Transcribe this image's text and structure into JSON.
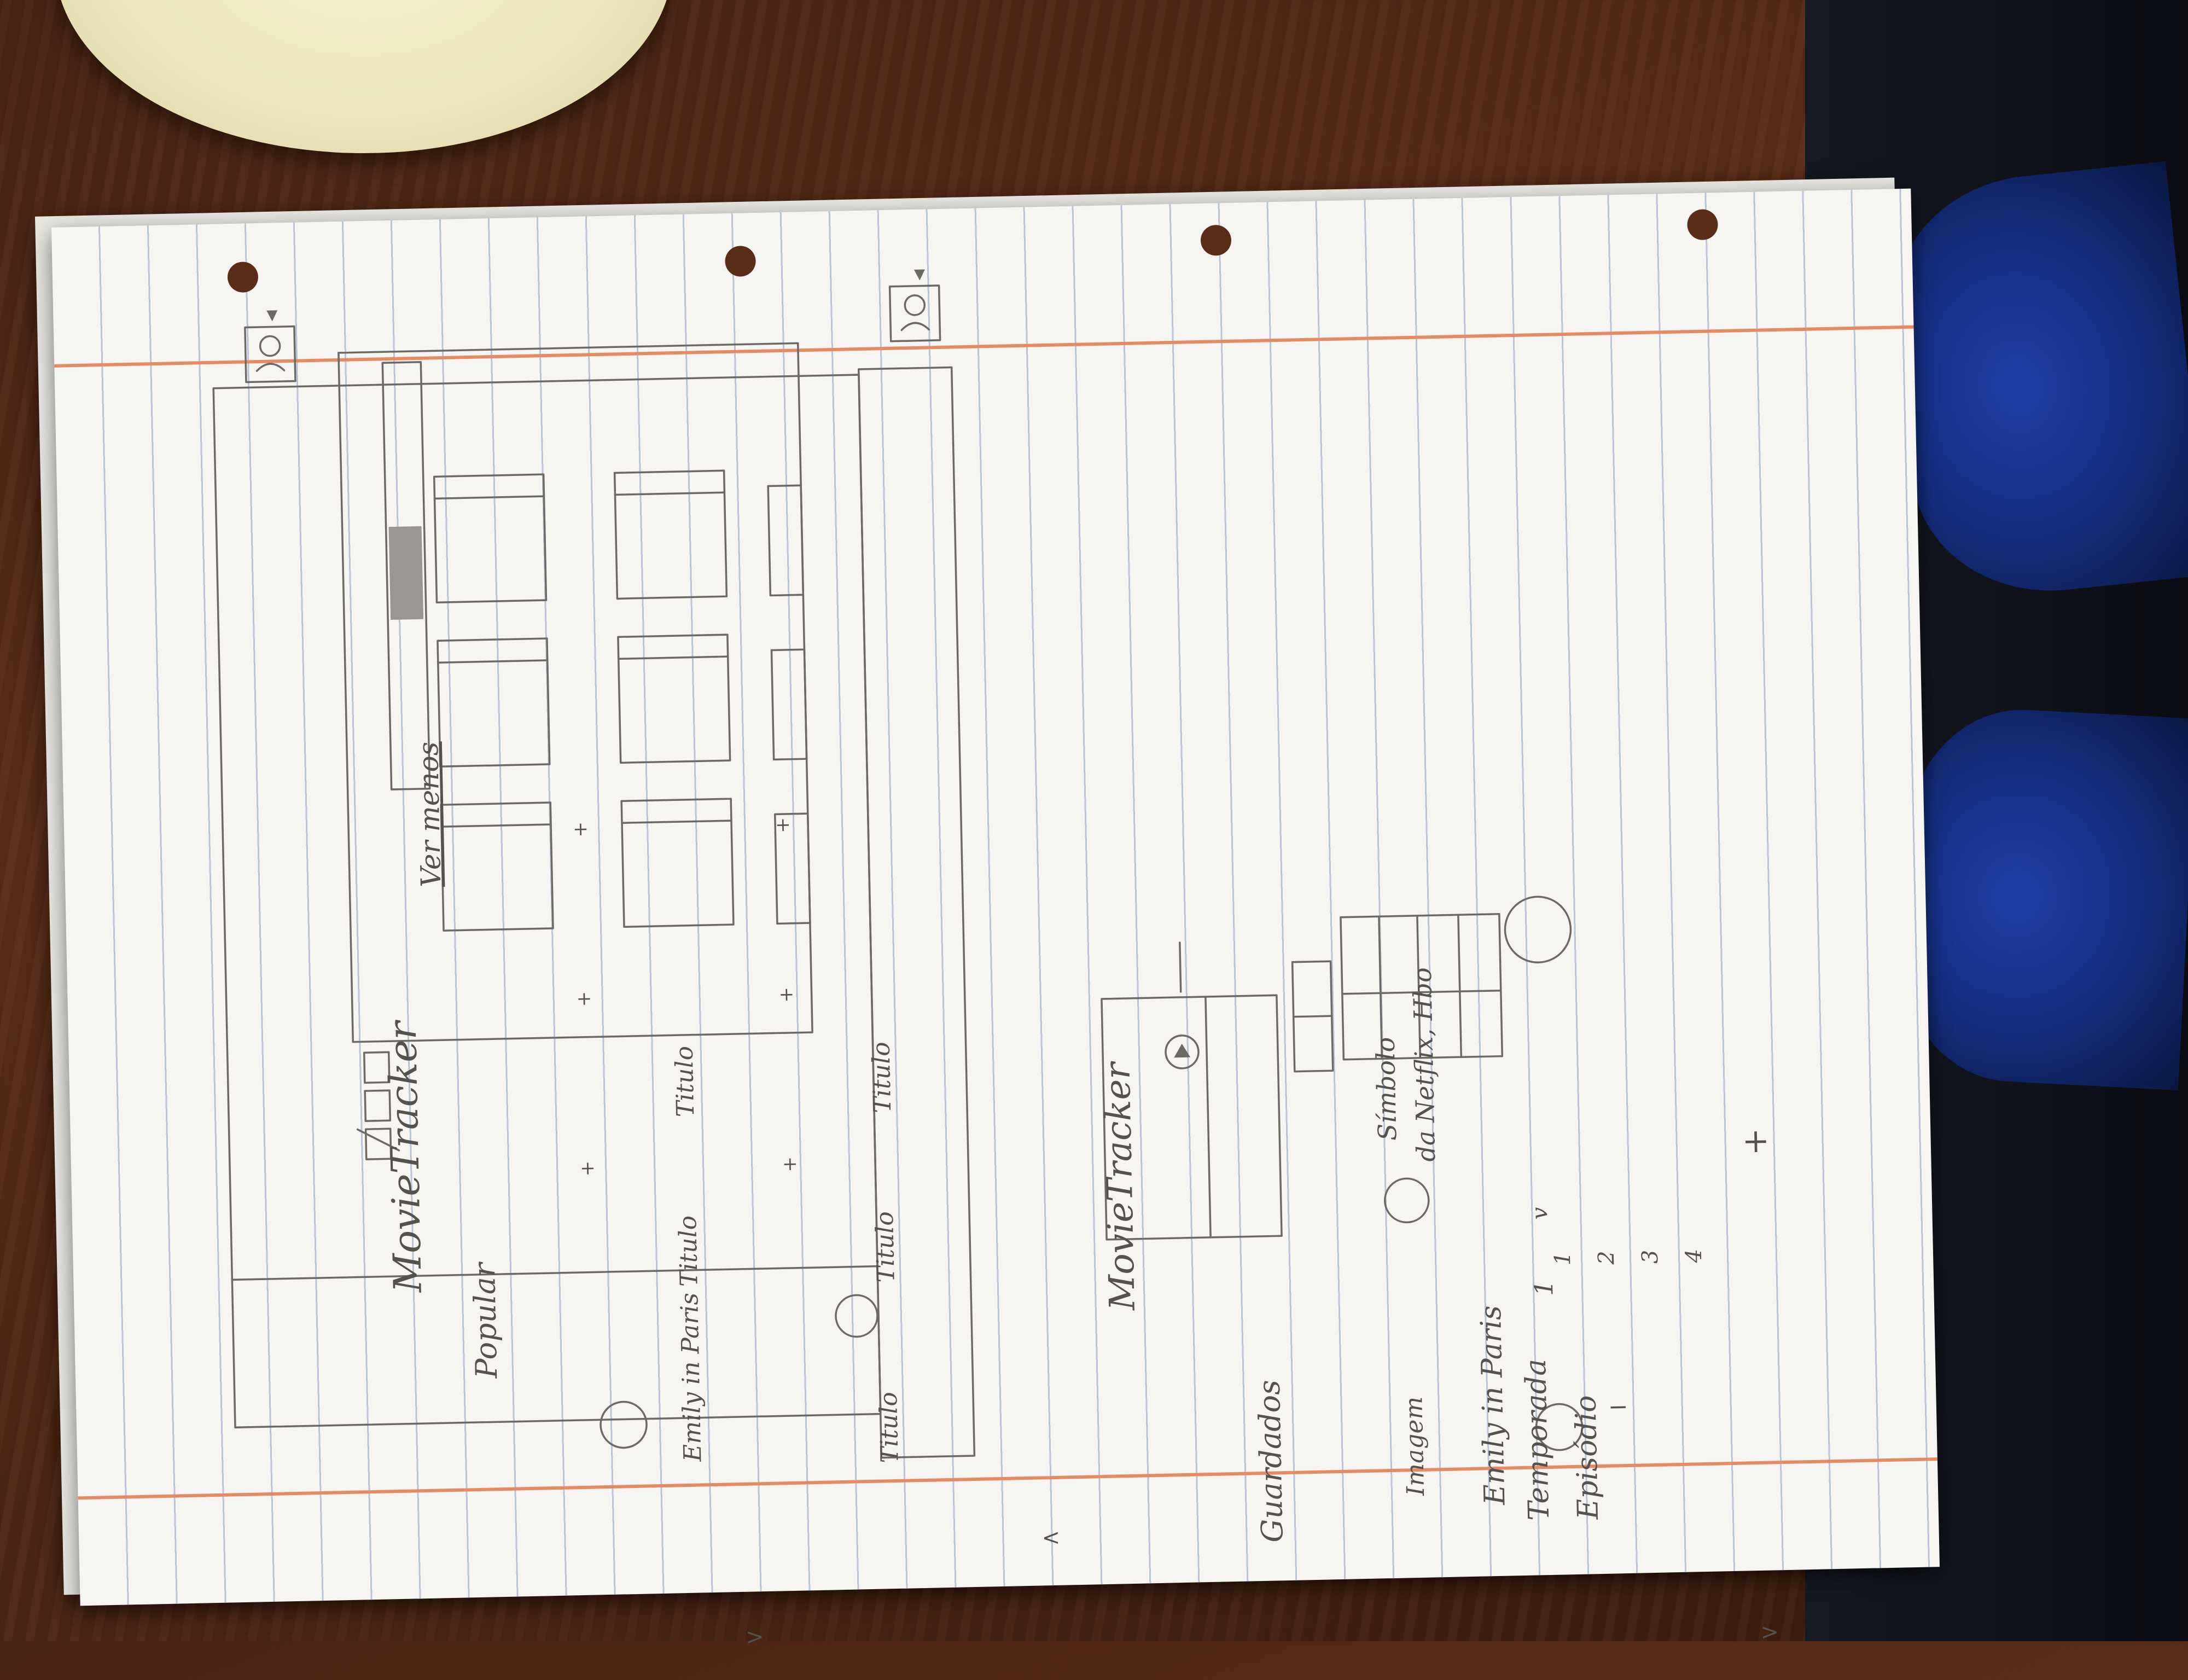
{
  "photo": {
    "screen_top": {
      "app_title": "MovieTracker",
      "section": "Popular",
      "see_more": "Ver menos",
      "featured_title": "Emily in Paris",
      "card_title": "Titulo",
      "add_symbol": "+",
      "next_symbol": ">",
      "prev_symbol": "<"
    },
    "screen_bottom": {
      "app_title": "MovieTracker",
      "section": "Guardados",
      "image_label": "Imagem",
      "annotation_line1": "Símbolo",
      "annotation_line2": "da Netflix, Hbo",
      "show_title": "Emily in Paris",
      "season_label": "Temporada",
      "season_value": "1",
      "dropdown_symbol": "v",
      "episode_label": "Episódio",
      "episode_options": [
        "1",
        "2",
        "3",
        "4"
      ],
      "minus_symbol": "−",
      "plus_symbol": "+",
      "next_symbol": ">"
    }
  }
}
